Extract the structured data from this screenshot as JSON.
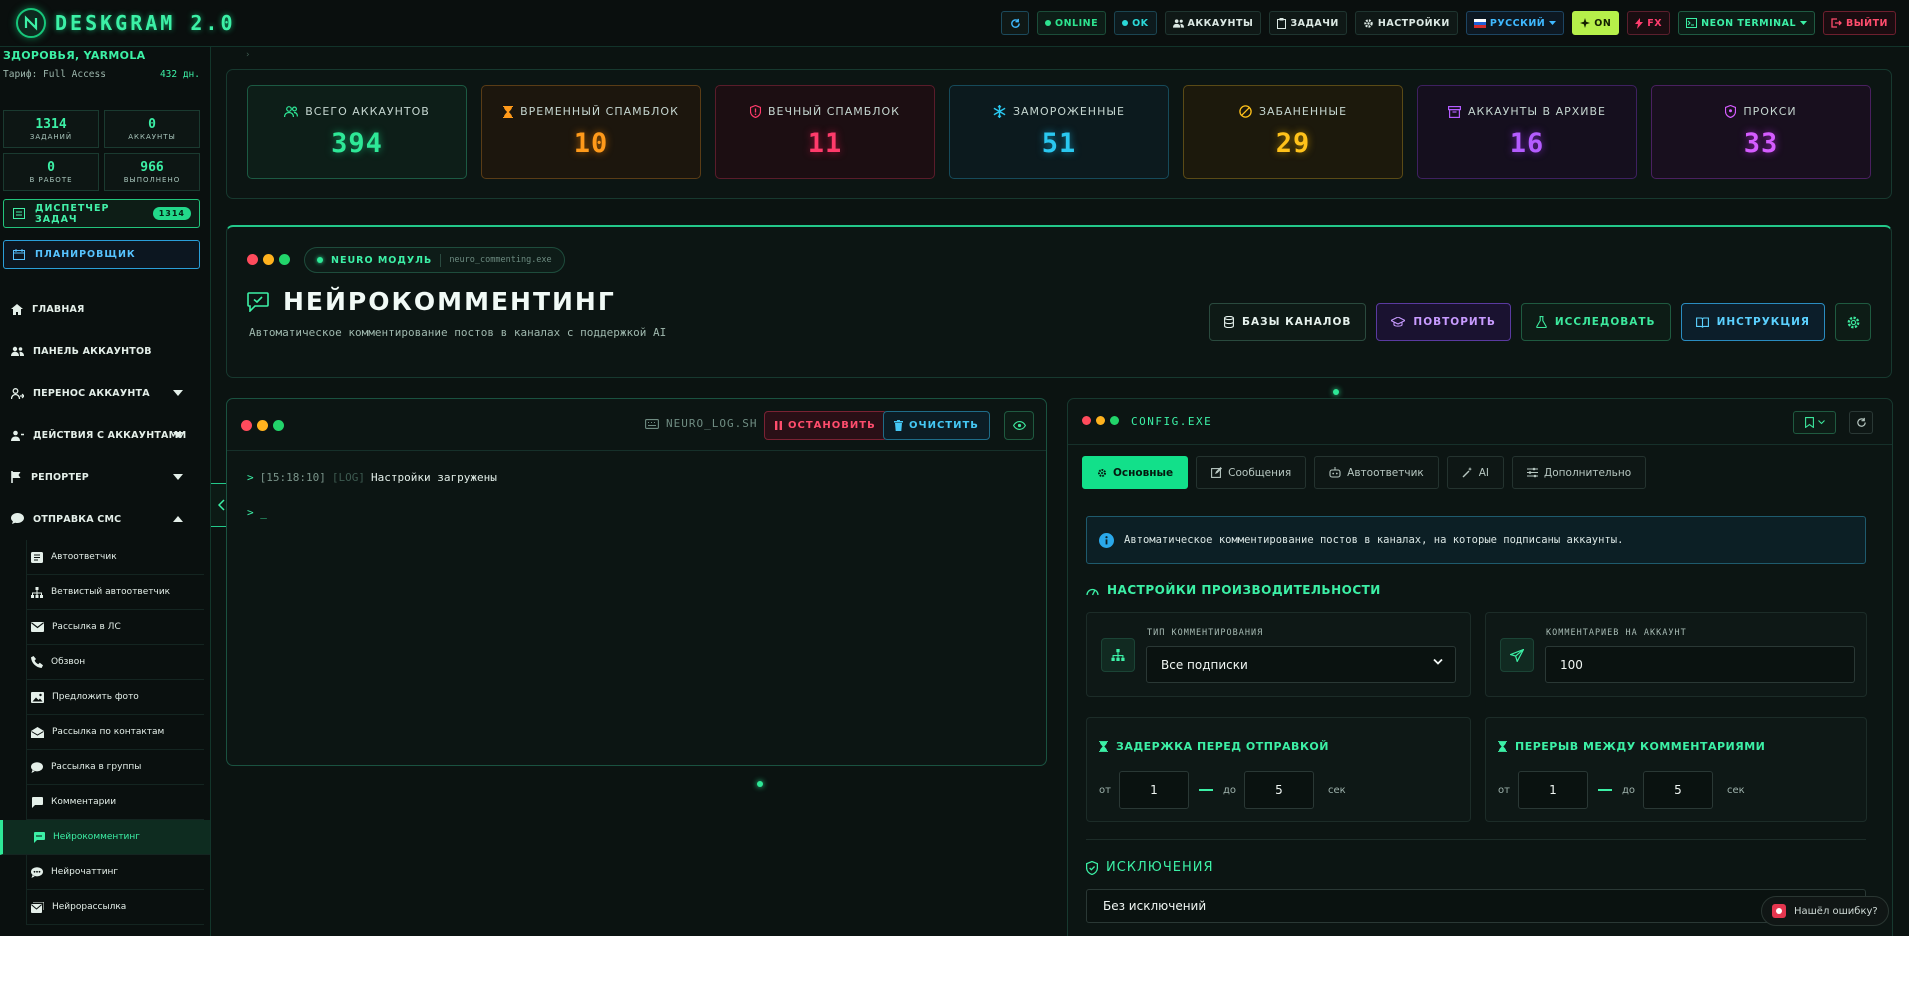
{
  "app": {
    "title": "DESKGRAM 2.0"
  },
  "topbar": {
    "online": "ONLINE",
    "ok": "OK",
    "accounts": "АККАУНТЫ",
    "tasks": "ЗАДАЧИ",
    "settings": "НАСТРОЙКИ",
    "language": "РУССКИЙ",
    "on": "ON",
    "fx": "FX",
    "theme": "NEON TERMINAL",
    "logout": "ВЫЙТИ"
  },
  "sidebar": {
    "user": "ЗДОРОВЬЯ, YARMOLA",
    "tariff": "Тариф: Full Access",
    "days": "432 дн.",
    "stats": [
      {
        "value": "1314",
        "label": "ЗАДАНИЙ"
      },
      {
        "value": "0",
        "label": "АККАУНТЫ"
      },
      {
        "value": "0",
        "label": "В РАБОТЕ"
      },
      {
        "value": "966",
        "label": "ВЫПОЛНЕНО"
      }
    ],
    "dispatcher": "ДИСПЕТЧЕР ЗАДАЧ",
    "dispatcher_badge": "1314",
    "planner": "ПЛАНИРОВЩИК",
    "nav": [
      {
        "label": "ГЛАВНАЯ"
      },
      {
        "label": "ПАНЕЛЬ АККАУНТОВ"
      },
      {
        "label": "ПЕРЕНОС АККАУНТА"
      },
      {
        "label": "ДЕЙСТВИЯ С АККАУНТАМИ"
      },
      {
        "label": "РЕПОРТЕР"
      },
      {
        "label": "ОТПРАВКА СМС"
      }
    ],
    "sub": [
      {
        "label": "Автоответчик"
      },
      {
        "label": "Ветвистый автоответчик"
      },
      {
        "label": "Рассылка в ЛС"
      },
      {
        "label": "Обзвон"
      },
      {
        "label": "Предложить фото"
      },
      {
        "label": "Рассылка по контактам"
      },
      {
        "label": "Рассылка в группы"
      },
      {
        "label": "Комментарии"
      },
      {
        "label": "Нейрокомментинг"
      },
      {
        "label": "Нейрочаттинг"
      },
      {
        "label": "Нейрорассылка"
      }
    ]
  },
  "stats": [
    {
      "label": "ВСЕГО АККАУНТОВ",
      "value": "394",
      "color": "#2ee897",
      "icon": "users-icon"
    },
    {
      "label": "ВРЕМЕННЫЙ СПАМБЛОК",
      "value": "10",
      "color": "#ff9a1a",
      "icon": "hourglass-icon"
    },
    {
      "label": "ВЕЧНЫЙ СПАМБЛОК",
      "value": "11",
      "color": "#ff3b6b",
      "icon": "shield-alert-icon"
    },
    {
      "label": "ЗАМОРОЖЕННЫЕ",
      "value": "51",
      "color": "#2ac8f0",
      "icon": "snowflake-icon"
    },
    {
      "label": "ЗАБАНЕННЫЕ",
      "value": "29",
      "color": "#ffc21a",
      "icon": "ban-icon"
    },
    {
      "label": "АККАУНТЫ В АРХИВЕ",
      "value": "16",
      "color": "#b45cff",
      "icon": "archive-icon"
    },
    {
      "label": "ПРОКСИ",
      "value": "33",
      "color": "#d55cff",
      "icon": "proxy-shield-icon"
    }
  ],
  "hero": {
    "pill_label": "NEURO МОДУЛЬ",
    "pill_file": "neuro_commenting.exe",
    "title": "НЕЙРОКОММЕНТИНГ",
    "description": "Автоматическое комментирование постов в каналах с поддержкой AI",
    "buttons": {
      "channels": "БАЗЫ КАНАЛОВ",
      "repeat": "ПОВТОРИТЬ",
      "explore": "ИССЛЕДОВАТЬ",
      "guide": "ИНСТРУКЦИЯ"
    }
  },
  "log": {
    "file": "NEURO_LOG.SH",
    "stop": "ОСТАНОВИТЬ",
    "clear": "ОЧИСТИТЬ",
    "line": {
      "prompt": ">",
      "time": "[15:18:10]",
      "tag": "[LOG]",
      "message": "Настройки загружены"
    },
    "cursor": "> _"
  },
  "config": {
    "title": "CONFIG.EXE",
    "tabs": [
      {
        "label": "Основные"
      },
      {
        "label": "Сообщения"
      },
      {
        "label": "Автоответчик"
      },
      {
        "label": "AI"
      },
      {
        "label": "Дополнительно"
      }
    ],
    "info": "Автоматическое комментирование постов в каналах, на которые подписаны аккаунты.",
    "perf_title": "НАСТРОЙКИ ПРОИЗВОДИТЕЛЬНОСТИ",
    "type_label": "ТИП КОММЕНТИРОВАНИЯ",
    "type_value": "Все подписки",
    "per_account_label": "КОММЕНТАРИЕВ НА АККАУНТ",
    "per_account_value": "100",
    "delay_title": "ЗАДЕРЖКА ПЕРЕД ОТПРАВКОЙ",
    "break_title": "ПЕРЕРЫВ МЕЖДУ КОММЕНТАРИЯМИ",
    "from": "от",
    "to": "до",
    "unit": "сек",
    "delay_from": "1",
    "delay_to": "5",
    "break_from": "1",
    "break_to": "5",
    "excl_title": "ИСКЛЮЧЕНИЯ",
    "excl_value": "Без исключений"
  },
  "bug_report": "Нашёл ошибку?"
}
